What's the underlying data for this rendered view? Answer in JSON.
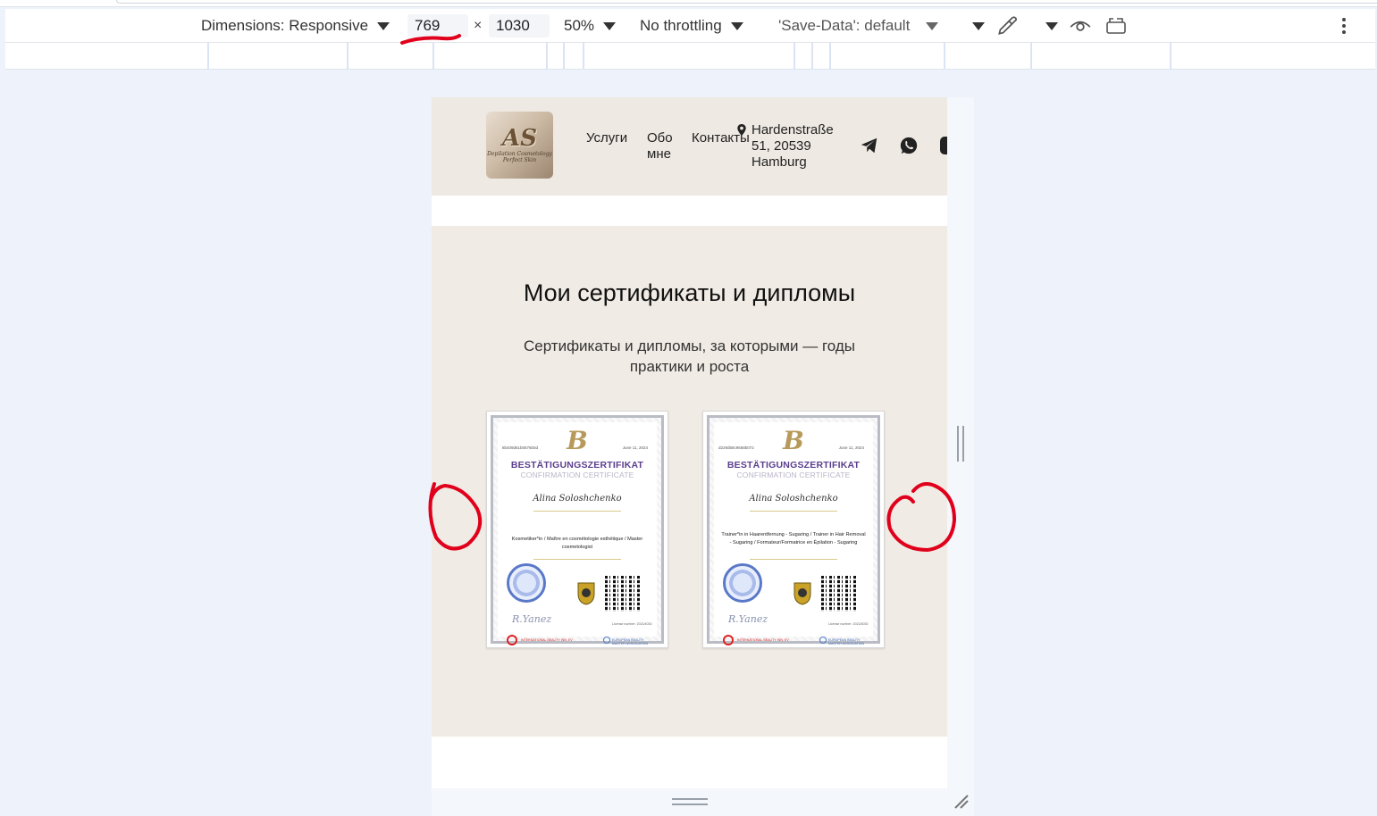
{
  "toolbar": {
    "dimensions_label": "Dimensions: Responsive",
    "width_value": "769",
    "times": "×",
    "height_value": "1030",
    "zoom": "50%",
    "throttling": "No throttling",
    "save_data": "'Save-Data': default"
  },
  "site": {
    "logo": {
      "monogram": "AS",
      "tagline": "Depilation Cosmetology Perfect Skin"
    },
    "nav": {
      "services": "Услуги",
      "about_line1": "Обо",
      "about_line2": "мне",
      "contacts": "Контакты"
    },
    "address": {
      "line1": "Hardenstraße",
      "line2": "51, 20539",
      "line3": "Hamburg"
    }
  },
  "section": {
    "title": "Мои сертификаты и дипломы",
    "subtitle": "Сертификаты и дипломы, за которыми — годы практики и роста"
  },
  "certificates": [
    {
      "number": "8b409d61b0576b0d",
      "date": "June 11, 2024",
      "monogram": "B",
      "title": "BESTÄTIGUNGSZERTIFIKAT",
      "subtitle": "CONFIRMATION CERTIFICATE",
      "name": "Alina Soloshchenko",
      "description": "Kosmetiker*in / Maître en cosmétologie esthétique / Master cosmetologist",
      "signature": "R.Yanez",
      "license": "License number: 2021/4030",
      "org_left": "INTERNATIONAL BEAUTY INN. EV",
      "org_right": "EUROPEAN BEAUTY MASTER ASSOCIATION"
    },
    {
      "number": "d229d58c9658b072",
      "date": "June 11, 2024",
      "monogram": "B",
      "title": "BESTÄTIGUNGSZERTIFIKAT",
      "subtitle": "CONFIRMATION CERTIFICATE",
      "name": "Alina Soloshchenko",
      "description": "Trainer*in in Haarentfernung - Sugaring / Trainer in Hair Removal - Sugaring / Formateur/Formatrice en Épilation - Sugaring",
      "signature": "R.Yanez",
      "license": "License number: 2021/5030",
      "org_left": "INTERNATIONAL BEAUTY INN. EV",
      "org_right": "EUROPEAN BEAUTY MASTER ASSOCIATION"
    }
  ],
  "colors": {
    "accent_header": "#eee9e2",
    "section_bg": "#f0ebe4",
    "cert_title": "#5b3e8e",
    "annotation_red": "#e0001b"
  },
  "icons": [
    "location-pin-icon",
    "telegram-icon",
    "whatsapp-icon",
    "instagram-icon",
    "eyedropper-icon",
    "eye-icon",
    "rotate-device-icon",
    "more-vertical-icon"
  ]
}
